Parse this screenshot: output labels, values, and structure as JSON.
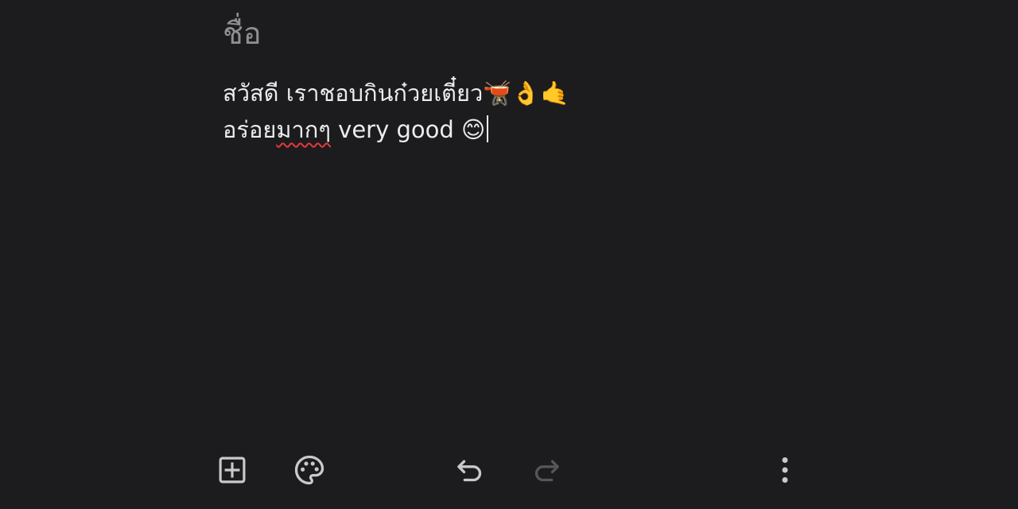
{
  "note": {
    "title_placeholder": "ชื่อ",
    "body_line1": "สวัสดี เราชอบกินก๋วยเตี๋ยว🫕👌🤙",
    "body_line2_before": "อร่อย",
    "body_line2_misspelled": "มากๆ",
    "body_line2_after": " very good 😊"
  },
  "toolbar": {
    "icons": [
      "add-box-icon",
      "palette-icon",
      "undo-icon",
      "redo-icon",
      "more-vert-icon"
    ],
    "redo_enabled": false
  },
  "colors": {
    "background": "#1c1c1f",
    "text": "#ececec",
    "placeholder": "#8f8f93",
    "icon": "#c9c9cc",
    "icon_disabled": "#56565a",
    "spell_underline": "#e53935"
  }
}
